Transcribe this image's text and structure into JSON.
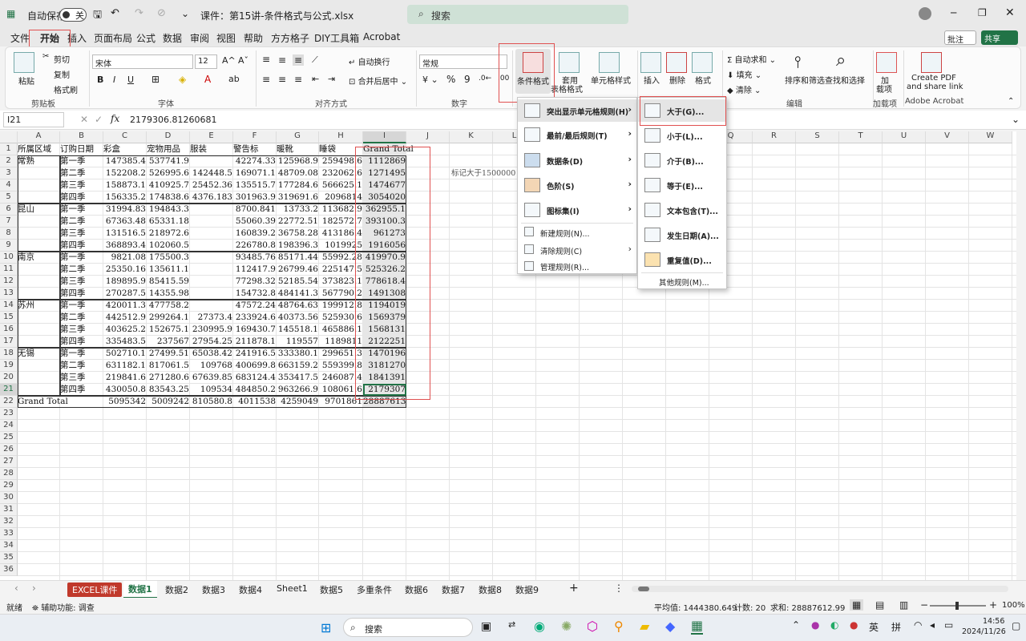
{
  "titlebar": {
    "autosave": "自动保存",
    "autosave_state": "关",
    "doc": "课件：第15讲-条件格式与公式.xlsx",
    "search": "搜索"
  },
  "menu_tabs": [
    "文件",
    "开始",
    "插入",
    "页面布局",
    "公式",
    "数据",
    "审阅",
    "视图",
    "帮助",
    "方方格子",
    "DIY工具箱",
    "Acrobat"
  ],
  "ribbon_right": {
    "comment": "批注",
    "share": "共享"
  },
  "ribbon": {
    "paste": "粘贴",
    "cut": "剪切",
    "copy": "复制",
    "painter": "格式刷",
    "clipboard": "剪贴板",
    "font_name": "宋体",
    "font_size": "12",
    "font": "字体",
    "align": "对齐方式",
    "wrap": "自动换行",
    "merge": "合并后居中",
    "numfmt": "常规",
    "number": "数字",
    "cond": "条件格式",
    "table1": "套用",
    "table2": "表格格式",
    "cellstyle": "单元格样式",
    "insert": "插入",
    "delete": "删除",
    "format": "格式",
    "autosum": "自动求和",
    "fill": "填充",
    "clear": "清除",
    "sort": "排序和筛选",
    "find": "查找和选择",
    "edit": "编辑",
    "addin1": "加",
    "addin2": "载项",
    "addins": "加载项",
    "pdf1": "Create PDF",
    "pdf2": "and share link",
    "acrobat": "Adobe Acrobat"
  },
  "formula": {
    "namebox": "I21",
    "fx": "fx",
    "value": "2179306.81260681"
  },
  "columns": [
    "A",
    "B",
    "C",
    "D",
    "E",
    "F",
    "G",
    "H",
    "I",
    "J",
    "K",
    "L",
    "M",
    "N",
    "O",
    "P",
    "Q",
    "R",
    "S",
    "T",
    "U",
    "V",
    "W"
  ],
  "rows_count": 36,
  "headers": [
    "所属区域",
    "订购日期",
    "彩盒",
    "宠物用品",
    "服装",
    "警告标",
    "暖靴",
    "睡袋",
    "Grand Total"
  ],
  "regions": [
    {
      "name": "常熟",
      "row": 2
    },
    {
      "name": "昆山",
      "row": 6
    },
    {
      "name": "南京",
      "row": 10
    },
    {
      "name": "苏州",
      "row": 14
    },
    {
      "name": "无锡",
      "row": 18
    }
  ],
  "data": [
    [
      "第一季",
      "147385.4",
      "537741.9",
      "",
      "42274.33",
      "125968.9",
      "259498.6",
      "1112869"
    ],
    [
      "第二季",
      "152208.2",
      "526995.6",
      "142448.5",
      "169071.1",
      "48709.08",
      "232062.6",
      "1271495"
    ],
    [
      "第三季",
      "158873.1",
      "410925.7",
      "25452.36",
      "135515.7",
      "177284.6",
      "566625.1",
      "1474677"
    ],
    [
      "第四季",
      "156335.2",
      "174838.6",
      "4376.183",
      "301963.9",
      "319691.6",
      "2096814",
      "3054020"
    ],
    [
      "第一季",
      "31994.83",
      "194843.3",
      "",
      "8700.841",
      "13733.2",
      "113682.9",
      "362955.1"
    ],
    [
      "第二季",
      "67363.48",
      "65331.18",
      "",
      "55060.39",
      "22772.51",
      "182572.7",
      "393100.3"
    ],
    [
      "第三季",
      "131516.5",
      "218972.6",
      "",
      "160839.2",
      "36758.28",
      "413186.4",
      "961273"
    ],
    [
      "第四季",
      "368893.4",
      "102060.5",
      "",
      "226780.8",
      "198396.3",
      "1019925",
      "1916056"
    ],
    [
      "第一季",
      "9821.08",
      "175500.3",
      "",
      "93485.76",
      "85171.44",
      "55992.28",
      "419970.9"
    ],
    [
      "第二季",
      "25350.16",
      "135611.1",
      "",
      "112417.9",
      "26799.46",
      "225147.5",
      "525326.2"
    ],
    [
      "第三季",
      "189895.9",
      "85415.59",
      "",
      "77298.32",
      "52185.54",
      "373823.1",
      "778618.4"
    ],
    [
      "第四季",
      "270287.5",
      "14355.98",
      "",
      "154732.8",
      "484141.3",
      "567790.2",
      "1491308"
    ],
    [
      "第一季",
      "420011.3",
      "477758.2",
      "",
      "47572.24",
      "48764.63",
      "199912.8",
      "1194019"
    ],
    [
      "第二季",
      "442512.9",
      "299264.1",
      "27373.4",
      "233924.6",
      "40373.56",
      "525930.6",
      "1569379"
    ],
    [
      "第三季",
      "403625.2",
      "152675.1",
      "230995.9",
      "169430.7",
      "145518.1",
      "465886.1",
      "1568131"
    ],
    [
      "第四季",
      "335483.5",
      "237567",
      "27954.25",
      "211878.1",
      "119557",
      "1189811",
      "2122251"
    ],
    [
      "第一季",
      "502710.1",
      "27499.51",
      "65038.42",
      "241916.5",
      "333380.1",
      "299651.3",
      "1470196"
    ],
    [
      "第二季",
      "631182.1",
      "817061.5",
      "109768",
      "400699.8",
      "663159.2",
      "559399.8",
      "3181270"
    ],
    [
      "第三季",
      "219841.6",
      "271280.6",
      "67639.85",
      "683124.4",
      "353417.5",
      "246087.4",
      "1841391"
    ],
    [
      "第四季",
      "430050.8",
      "83543.25",
      "109534",
      "484850.2",
      "963266.9",
      "108061.6",
      "2179307"
    ]
  ],
  "grand_total": {
    "label": "Grand Total",
    "values": [
      "5095342",
      "5009242",
      "810580.8",
      "4011538",
      "4259049",
      "9701861",
      "28887613"
    ]
  },
  "note": "标记大于1500000",
  "cf_menu": [
    "突出显示单元格规则(H)",
    "最前/最后规则(T)",
    "数据条(D)",
    "色阶(S)",
    "图标集(I)",
    "新建规则(N)...",
    "清除规则(C)",
    "管理规则(R)..."
  ],
  "sub_menu": [
    "大于(G)...",
    "小于(L)...",
    "介于(B)...",
    "等于(E)...",
    "文本包含(T)...",
    "发生日期(A)...",
    "重复值(D)...",
    "其他规则(M)..."
  ],
  "sheet_tabs": [
    "EXCEL课件",
    "数据1",
    "数据2",
    "数据3",
    "数据4",
    "Sheet1",
    "数据5",
    "多重条件",
    "数据6",
    "数据7",
    "数据8",
    "数据9"
  ],
  "status": {
    "ready": "就绪",
    "access": "辅助功能: 调查",
    "avg": "平均值: 1444380.649",
    "count": "计数: 20",
    "sum": "求和: 28887612.99",
    "zoom": "100%"
  },
  "taskbar": {
    "search": "搜索",
    "ime1": "英",
    "ime2": "拼",
    "time": "14:56",
    "date": "2024/11/26"
  },
  "colors": {
    "accent": "#217346",
    "red": "#e05050",
    "selected": "#d6d6d6"
  }
}
